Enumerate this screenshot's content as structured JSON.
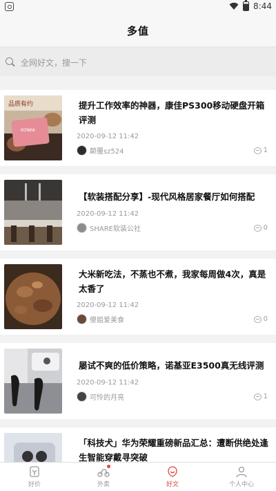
{
  "status": {
    "time": "8:44"
  },
  "header": {
    "title": "多值"
  },
  "search": {
    "placeholder": "全网好文，搜一下"
  },
  "articles": [
    {
      "title": "提升工作效率的神器，康佳PS300移动硬盘开箱评测",
      "time": "2020-09-12 11:42",
      "author": "颠覆sz524",
      "comments": "1"
    },
    {
      "title": "【软装搭配分享】-现代风格居家餐厅如何搭配",
      "time": "2020-09-12 11:42",
      "author": "SHARE软装公社",
      "comments": "0"
    },
    {
      "title": "大米新吃法，不蒸也不煮，我家每周做4次，真是太香了",
      "time": "2020-09-12 11:42",
      "author": "傻姐爱美食",
      "comments": "0"
    },
    {
      "title": "屡试不爽的低价策略，诺基亚E3500真无线评测",
      "time": "2020-09-12 11:42",
      "author": "可怜的月亮",
      "comments": "1"
    },
    {
      "title": "「科技犬」华为荣耀重磅新品汇总：遭断供绝处逢生智能穿戴寻突破",
      "time": "",
      "author": "",
      "comments": ""
    }
  ],
  "tabs": [
    {
      "label": "好价",
      "icon": "price-tag-icon"
    },
    {
      "label": "外卖",
      "icon": "delivery-bike-icon"
    },
    {
      "label": "好文",
      "icon": "article-icon"
    },
    {
      "label": "个人中心",
      "icon": "person-icon"
    }
  ],
  "colors": {
    "accent": "#e3443d",
    "background": "#f2f2f2"
  }
}
